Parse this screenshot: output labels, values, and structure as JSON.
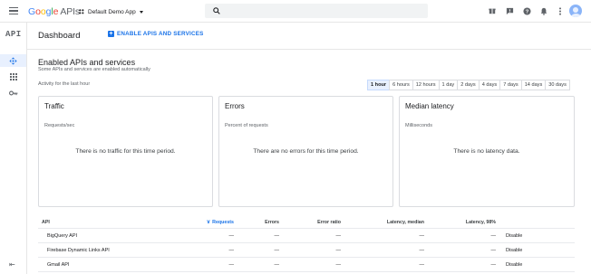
{
  "topbar": {
    "logo_parts": [
      "G",
      "o",
      "o",
      "g",
      "l",
      "e"
    ],
    "logo_suffix": "APIs",
    "project_name": "Default Demo App",
    "search_placeholder": "",
    "icons": [
      "gift-icon",
      "chat-icon",
      "help-icon",
      "notifications-icon",
      "more-vert-icon",
      "account-avatar"
    ]
  },
  "rail": {
    "label": "API",
    "items": [
      "dashboard-icon",
      "library-icon",
      "credentials-icon"
    ],
    "collapse_glyph": "⇤"
  },
  "header": {
    "title": "Dashboard",
    "enable_label": "ENABLE APIS AND SERVICES"
  },
  "section": {
    "title": "Enabled APIs and services",
    "subtitle": "Some APIs and services are enabled automatically",
    "activity_label": "Activity for the last hour"
  },
  "time_ranges": {
    "selected": "1 hour",
    "options": [
      "1 hour",
      "6 hours",
      "12 hours",
      "1 day",
      "2 days",
      "4 days",
      "7 days",
      "14 days",
      "30 days"
    ]
  },
  "cards": [
    {
      "title": "Traffic",
      "subtitle": "Requests/sec",
      "empty": "There is no traffic for this time period."
    },
    {
      "title": "Errors",
      "subtitle": "Percent of requests",
      "empty": "There are no errors for this time period."
    },
    {
      "title": "Median latency",
      "subtitle": "Milliseconds",
      "empty": "There is no latency data."
    }
  ],
  "table": {
    "columns": [
      "API",
      "Requests",
      "Errors",
      "Error ratio",
      "Latency, median",
      "Latency, 98%"
    ],
    "sort_glyph": "∨",
    "rows": [
      {
        "api": "BigQuery API",
        "requests": "—",
        "errors": "—",
        "ratio": "—",
        "median": "—",
        "p98": "—",
        "action": "Disable"
      },
      {
        "api": "Firebase Dynamic Links API",
        "requests": "—",
        "errors": "—",
        "ratio": "—",
        "median": "—",
        "p98": "—",
        "action": "Disable"
      },
      {
        "api": "Gmail API",
        "requests": "—",
        "errors": "—",
        "ratio": "—",
        "median": "—",
        "p98": "—",
        "action": "Disable"
      }
    ]
  },
  "colors": {
    "accent": "#1a73e8",
    "selected_bg": "#e8f0fe",
    "border": "#dadce0"
  }
}
